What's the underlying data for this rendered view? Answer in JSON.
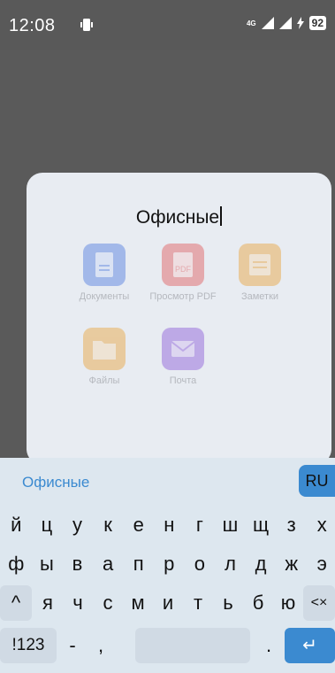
{
  "status_bar": {
    "time": "12:08",
    "network": "4G",
    "battery": "92"
  },
  "folder": {
    "title": "Офисные",
    "apps": [
      {
        "label": "Документы",
        "color": "#4f7be0",
        "icon": "document-icon"
      },
      {
        "label": "Просмотр PDF",
        "color": "#e05a5a",
        "icon": "pdf-icon"
      },
      {
        "label": "Заметки",
        "color": "#e8a33a",
        "icon": "notes-icon"
      },
      {
        "label": "Файлы",
        "color": "#e8a33a",
        "icon": "folder-icon"
      },
      {
        "label": "Почта",
        "color": "#8b5ad8",
        "icon": "mail-icon"
      }
    ],
    "pdf_text": "PDF"
  },
  "keyboard": {
    "suggestion": "Офисные",
    "language": "RU",
    "row1": [
      "й",
      "ц",
      "у",
      "к",
      "е",
      "н",
      "г",
      "ш",
      "щ",
      "з",
      "х"
    ],
    "row2": [
      "ф",
      "ы",
      "в",
      "а",
      "п",
      "р",
      "о",
      "л",
      "д",
      "ж",
      "э"
    ],
    "row3": [
      "я",
      "ч",
      "с",
      "м",
      "и",
      "т",
      "ь",
      "б",
      "ю"
    ],
    "shift": "^",
    "backspace": "<×",
    "symbols": "!123",
    "dash": "-",
    "comma": ",",
    "period": ".",
    "enter": "↵"
  }
}
